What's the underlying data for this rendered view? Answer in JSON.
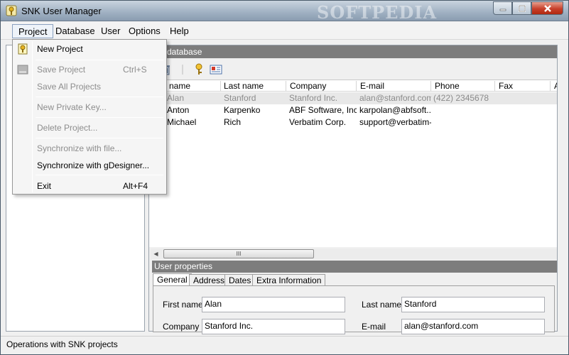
{
  "window": {
    "title": "SNK User Manager",
    "watermark": "SOFTPEDIA"
  },
  "menubar": [
    "Project",
    "Database",
    "User",
    "Options",
    "Help"
  ],
  "project_menu": {
    "items": [
      {
        "label": "New Project",
        "shortcut": "",
        "enabled": true
      },
      {
        "label": "Save Project",
        "shortcut": "Ctrl+S",
        "enabled": false
      },
      {
        "label": "Save All Projects",
        "shortcut": "",
        "enabled": false
      },
      {
        "label": "New Private Key...",
        "shortcut": "",
        "enabled": false
      },
      {
        "label": "Delete Project...",
        "shortcut": "",
        "enabled": false
      },
      {
        "label": "Synchronize with file...",
        "shortcut": "",
        "enabled": false
      },
      {
        "label": "Synchronize with gDesigner...",
        "shortcut": "",
        "enabled": true
      },
      {
        "label": "Exit",
        "shortcut": "Alt+F4",
        "enabled": true
      }
    ]
  },
  "database_panel": {
    "title": "database"
  },
  "grid": {
    "columns": [
      "name",
      "Last name",
      "Company",
      "E-mail",
      "Phone",
      "Fax",
      "A"
    ],
    "rows": [
      {
        "first": "Alan",
        "last": "Stanford",
        "company": "Stanford Inc.",
        "email": "alan@stanford.com",
        "phone": "(422) 2345678",
        "fax": "",
        "selected": true
      },
      {
        "first": "Anton",
        "last": "Karpenko",
        "company": "ABF Software, Inc.",
        "email": "karpolan@abfsoft...",
        "phone": "",
        "fax": "",
        "selected": false
      },
      {
        "first": "Michael",
        "last": "Rich",
        "company": "Verbatim Corp.",
        "email": "support@verbatim-...",
        "phone": "",
        "fax": "",
        "selected": false
      }
    ]
  },
  "scroll": {
    "thumb_grip": "III"
  },
  "user_properties": {
    "title": "User properties",
    "tabs": [
      "General",
      "Address",
      "Dates",
      "Extra Information"
    ],
    "fields": {
      "first_name_label": "First name",
      "first_name": "Alan",
      "last_name_label": "Last name",
      "last_name": "Stanford",
      "company_label": "Company",
      "company": "Stanford Inc.",
      "email_label": "E-mail",
      "email": "alan@stanford.com"
    }
  },
  "status": {
    "text": "Operations with SNK projects"
  },
  "colors": {
    "panel_header": "#7d7d7d",
    "close_button": "#c7402b",
    "selected_row": "#e8e8e8"
  }
}
